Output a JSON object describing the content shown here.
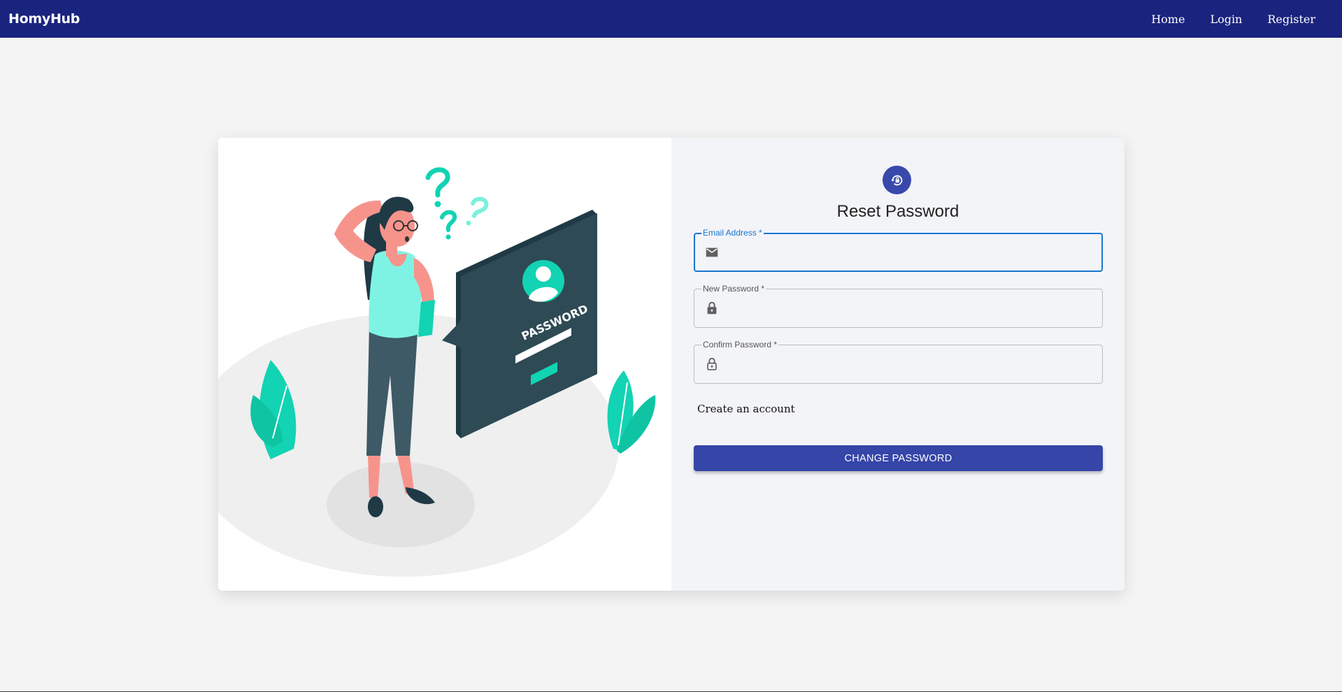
{
  "appbar": {
    "brand": "HomyHub",
    "nav": [
      "Home",
      "Login",
      "Register"
    ]
  },
  "illustration": {
    "sign_text": "PASSWORD"
  },
  "form": {
    "title": "Reset Password",
    "email_label": "Email Address *",
    "email_value": "",
    "new_password_label": "New Password *",
    "new_password_value": "",
    "confirm_password_label": "Confirm Password *",
    "confirm_password_value": "",
    "create_account_link": "Create an account",
    "submit_label": "CHANGE PASSWORD"
  },
  "icons": {
    "avatar": "lock-reset-icon",
    "email": "mail-icon",
    "new_password": "lock-icon",
    "confirm_password": "lock-open-icon"
  },
  "colors": {
    "appbar": "#1a237e",
    "primary_button": "#3545a8",
    "focus": "#1976d2",
    "avatar": "#3949ab",
    "accent_illustration": "#12d3b3"
  }
}
